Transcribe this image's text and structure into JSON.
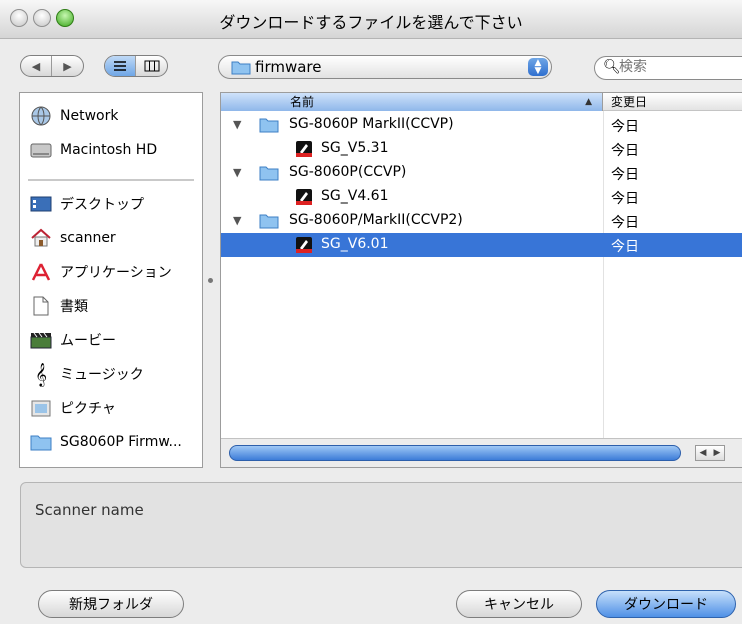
{
  "window": {
    "title": "ダウンロードするファイルを選んで下さい"
  },
  "toolbar": {
    "nav_back_icon": "back-arrow-icon",
    "nav_forward_icon": "forward-arrow-icon",
    "view_list_icon": "list-view-icon",
    "view_column_icon": "column-view-icon",
    "location": "firmware",
    "search_placeholder": "検索"
  },
  "sidebar": {
    "items": [
      {
        "label": "Network",
        "icon": "network-globe-icon"
      },
      {
        "label": "Macintosh HD",
        "icon": "hard-drive-icon"
      },
      {
        "label": "デスクトップ",
        "icon": "desktop-icon"
      },
      {
        "label": "scanner",
        "icon": "home-icon"
      },
      {
        "label": "アプリケーション",
        "icon": "applications-icon"
      },
      {
        "label": "書類",
        "icon": "documents-icon"
      },
      {
        "label": "ムービー",
        "icon": "movies-icon"
      },
      {
        "label": "ミュージック",
        "icon": "music-icon"
      },
      {
        "label": "ピクチャ",
        "icon": "pictures-icon"
      },
      {
        "label": "SG8060P Firmw...",
        "icon": "folder-icon"
      }
    ]
  },
  "filelist": {
    "columns": {
      "name": "名前",
      "date": "変更日"
    },
    "rows": [
      {
        "type": "folder",
        "name": "SG-8060P MarkII(CCVP)",
        "date": "今日",
        "selected": false
      },
      {
        "type": "file",
        "name": "SG_V5.31",
        "date": "今日",
        "selected": false
      },
      {
        "type": "folder",
        "name": "SG-8060P(CCVP)",
        "date": "今日",
        "selected": false
      },
      {
        "type": "file",
        "name": "SG_V4.61",
        "date": "今日",
        "selected": false
      },
      {
        "type": "folder",
        "name": "SG-8060P/MarkII(CCVP2)",
        "date": "今日",
        "selected": false
      },
      {
        "type": "file",
        "name": "SG_V6.01",
        "date": "今日",
        "selected": true
      }
    ]
  },
  "info": {
    "text": "Scanner name"
  },
  "buttons": {
    "new_folder": "新規フォルダ",
    "cancel": "キャンセル",
    "download": "ダウンロード"
  },
  "colors": {
    "selection": "#3875d7",
    "accent_button": "#4f90e6"
  }
}
